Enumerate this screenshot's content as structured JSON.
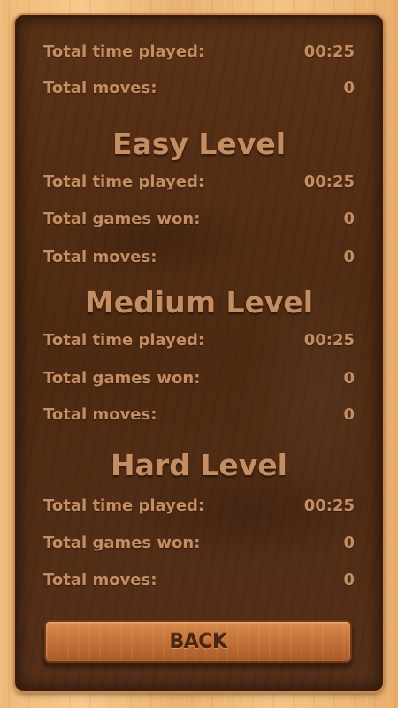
{
  "overall": {
    "time_label": "Total time played:",
    "time_value": "00:25",
    "moves_label": "Total moves:",
    "moves_value": "0"
  },
  "easy": {
    "title": "Easy Level",
    "time_label": "Total time played:",
    "time_value": "00:25",
    "won_label": "Total games won:",
    "won_value": "0",
    "moves_label": "Total moves:",
    "moves_value": "0"
  },
  "medium": {
    "title": "Medium Level",
    "time_label": "Total time played:",
    "time_value": "00:25",
    "won_label": "Total games won:",
    "won_value": "0",
    "moves_label": "Total moves:",
    "moves_value": "0"
  },
  "hard": {
    "title": "Hard Level",
    "time_label": "Total time played:",
    "time_value": "00:25",
    "won_label": "Total games won:",
    "won_value": "0",
    "moves_label": "Total moves:",
    "moves_value": "0"
  },
  "back_button": {
    "label": "BACK"
  },
  "colors": {
    "text": "#c48e62",
    "panel": "#4e2a12",
    "button": "#c5733a"
  }
}
